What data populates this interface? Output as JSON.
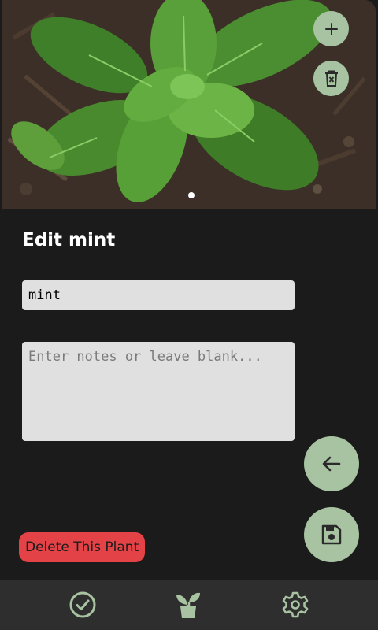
{
  "screen": {
    "title": "Edit mint"
  },
  "form": {
    "name_value": "mint",
    "notes_value": "",
    "notes_placeholder": "Enter notes or leave blank..."
  },
  "actions": {
    "delete_label": "Delete This Plant"
  },
  "photo": {
    "subject": "basil plant photo",
    "page_count": 1,
    "current_page": 1
  },
  "icons": {
    "add_photo": "plus-icon",
    "delete_photo": "trash-x-icon",
    "back": "arrow-left-icon",
    "save": "floppy-disk-icon",
    "nav_tasks": "check-circle-icon",
    "nav_plants": "potted-plant-icon",
    "nav_settings": "gear-icon"
  },
  "colors": {
    "background": "#1b1b1b",
    "accent": "#a7c3a1",
    "danger": "#e34346",
    "nav_background": "#2e2e2e",
    "input_background": "#e0e0e0"
  }
}
